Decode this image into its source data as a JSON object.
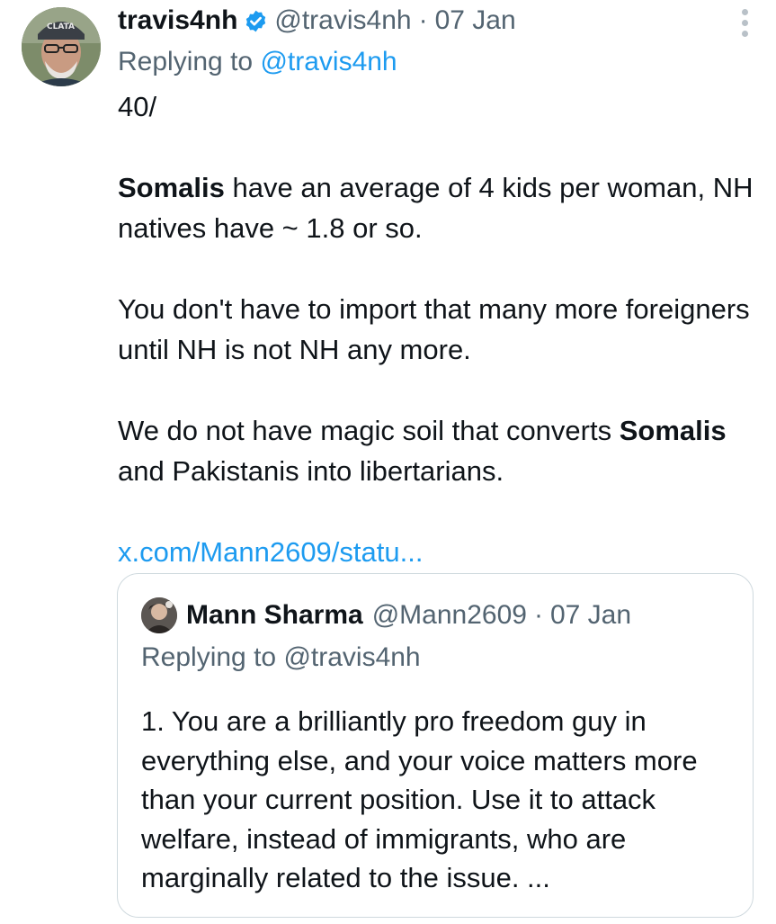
{
  "tweet": {
    "display_name": "travis4nh",
    "handle": "@travis4nh",
    "separator": "·",
    "date": "07 Jan",
    "replying_prefix": "Replying to",
    "replying_handle": "@travis4nh",
    "avatar_icon": "user-avatar-icon",
    "verified_icon": "verified-badge-icon",
    "verified_color": "#1d9bf0",
    "more_icon": "more-vertical-icon",
    "body": {
      "line1": "40/",
      "p2_bold": "Somalis",
      "p2_rest": " have an average of 4 kids per woman, NH natives have ~ 1.8 or so.",
      "p3": "You don't have to import that many more foreigners until NH is not NH any more.",
      "p4_start": "We do not have magic soil that converts ",
      "p4_bold": "Somalis",
      "p4_rest": " and Pakistanis into libertarians."
    },
    "link_text": "x.com/Mann2609/statu..."
  },
  "quote": {
    "display_name": "Mann Sharma",
    "handle": "@Mann2609",
    "separator": "·",
    "date": "07 Jan",
    "replying_prefix": "Replying to",
    "replying_handle": "@travis4nh",
    "avatar_icon": "quoted-user-avatar-icon",
    "body": "1. You are a brilliantly pro freedom guy in everything else, and your voice matters more than your current position. Use it to attack welfare, instead of immigrants, who are marginally related to the issue. ..."
  },
  "colors": {
    "text": "#0f1419",
    "secondary": "#536471",
    "link": "#1d9bf0",
    "border": "#cfd9de"
  }
}
